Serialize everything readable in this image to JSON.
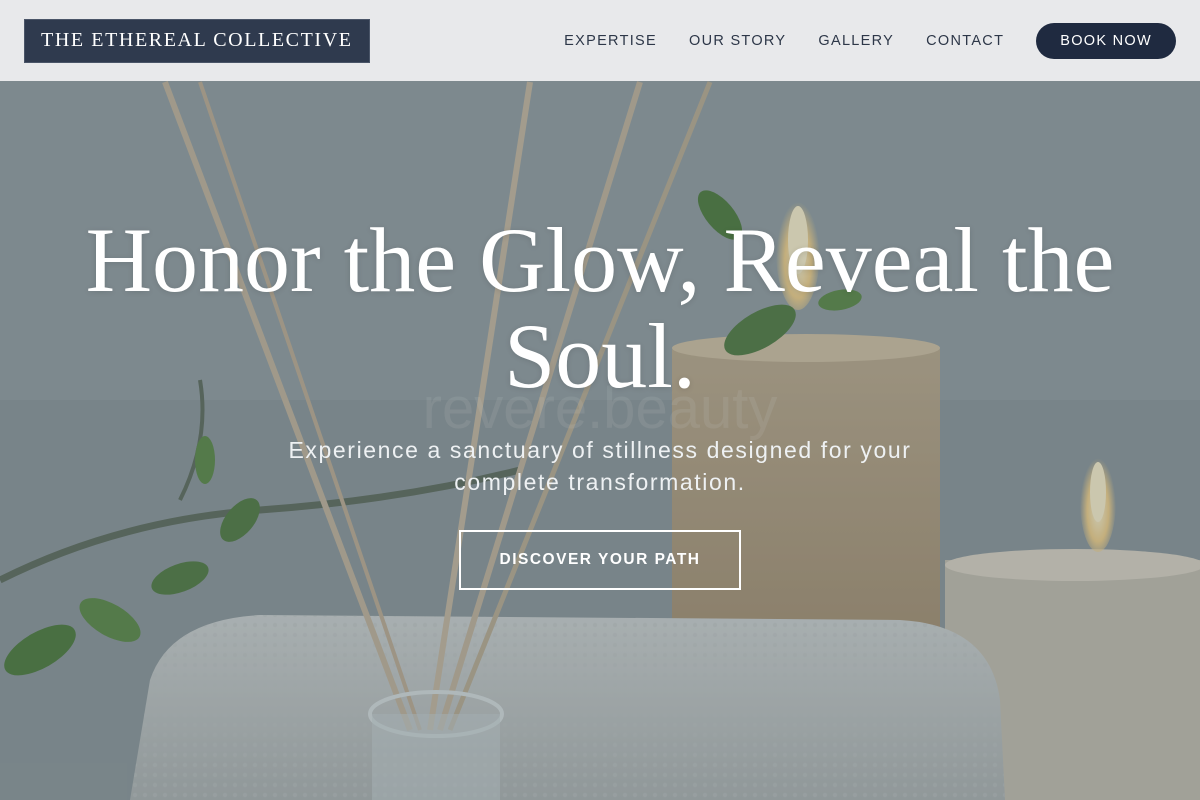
{
  "header": {
    "logo_text": "THE ETHEREAL COLLECTIVE",
    "nav": [
      {
        "label": "EXPERTISE"
      },
      {
        "label": "OUR STORY"
      },
      {
        "label": "GALLERY"
      },
      {
        "label": "CONTACT"
      }
    ],
    "book_label": "BOOK NOW"
  },
  "hero": {
    "title": "Honor the Glow, Reveal the Soul.",
    "subtitle": "Experience a sanctuary of stillness designed for your complete transformation.",
    "cta_label": "DISCOVER YOUR PATH",
    "background_image_text": "revere.beauty"
  },
  "colors": {
    "header_bg": "#ecedee",
    "logo_bg": "#2f3a4e",
    "book_button_bg": "#1f2a40",
    "text_dark": "#2d3748",
    "hero_text": "#ffffff"
  }
}
